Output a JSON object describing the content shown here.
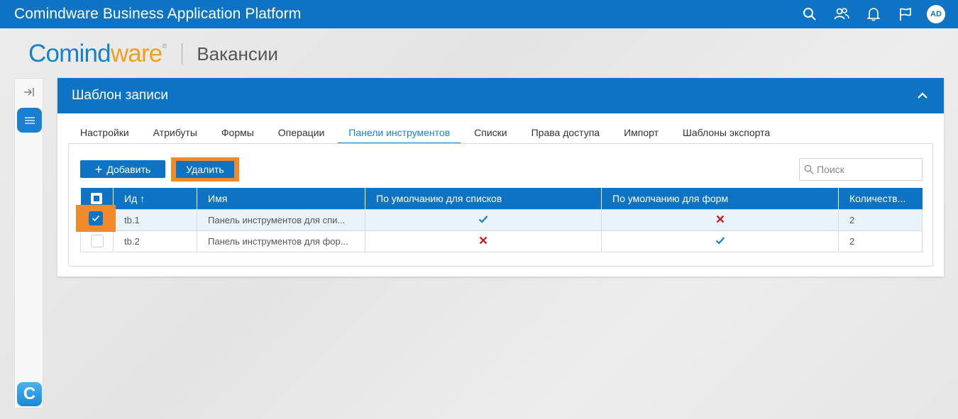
{
  "topbar": {
    "app_title": "Comindware Business Application Platform",
    "icons": [
      "search-icon",
      "users-icon",
      "bell-icon",
      "flag-icon"
    ],
    "avatar": "AD"
  },
  "header": {
    "logo_part1": "Comind",
    "logo_part2": "ware",
    "logo_mark": "®",
    "page_title": "Вакансии"
  },
  "sidebar": {
    "icons": [
      "expand-icon",
      "menu-icon"
    ],
    "app_letter": "C"
  },
  "panel": {
    "title": "Шаблон записи",
    "tabs": [
      {
        "label": "Настройки",
        "active": false
      },
      {
        "label": "Атрибуты",
        "active": false
      },
      {
        "label": "Формы",
        "active": false
      },
      {
        "label": "Операции",
        "active": false
      },
      {
        "label": "Панели инструментов",
        "active": true
      },
      {
        "label": "Списки",
        "active": false
      },
      {
        "label": "Права доступа",
        "active": false
      },
      {
        "label": "Импорт",
        "active": false
      },
      {
        "label": "Шаблоны экспорта",
        "active": false
      }
    ],
    "toolbar": {
      "add_label": "Добавить",
      "delete_label": "Удалить",
      "search_placeholder": "Поиск"
    },
    "table": {
      "columns": [
        "Ид",
        "Имя",
        "По умолчанию для списков",
        "По умолчанию для форм",
        "Количеств..."
      ],
      "sort_indicator": "↑",
      "rows": [
        {
          "selected": true,
          "id": "tb.1",
          "name": "Панель инструментов для спи...",
          "default_lists": true,
          "default_forms": false,
          "count": "2"
        },
        {
          "selected": false,
          "id": "tb.2",
          "name": "Панель инструментов для фор...",
          "default_lists": false,
          "default_forms": true,
          "count": "2"
        }
      ]
    }
  },
  "colors": {
    "primary": "#0f73c4",
    "highlight": "#f28a2c",
    "check": "#1a7fcf",
    "cross": "#c0262d"
  }
}
